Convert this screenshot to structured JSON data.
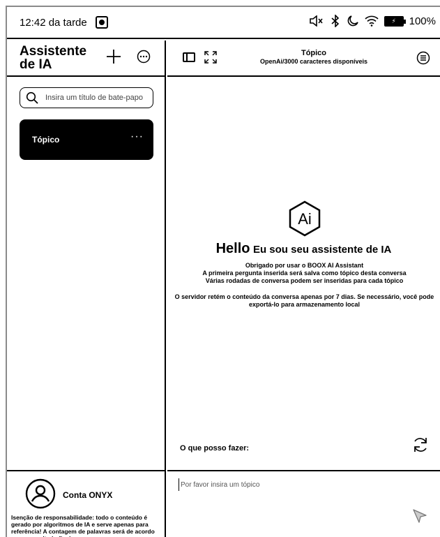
{
  "status_bar": {
    "time": "12:42 da tarde",
    "battery_level": "100%",
    "icons": [
      "mute-icon",
      "bluetooth-icon",
      "moon-icon",
      "wifi-icon",
      "battery-icon"
    ]
  },
  "sidebar": {
    "title": "Assistente de IA",
    "search_placeholder": "Insira um título de bate-papo",
    "topics": [
      {
        "label": "Tópico",
        "menu": "···"
      }
    ],
    "account_name": "Conta ONYX",
    "disclaimer": "Isenção de responsabilidade: todo o conteúdo é gerado por algoritmos de IA e serve apenas para referência! A contagem de palavras será de acordo com o resultado final."
  },
  "main": {
    "header_title": "Tópico",
    "header_subtitle": "OpenAi/3000 caracteres disponíveis",
    "logo_text": "Ai",
    "hello_big": "Hello",
    "hello_rest": "Eu sou seu assistente de IA",
    "intro_lines": [
      "Obrigado por usar o BOOX AI Assistant",
      "A primeira pergunta inserida será salva como tópico desta conversa",
      "Várias rodadas de conversa podem ser inseridas para cada tópico"
    ],
    "server_note": "O servidor retém o conteúdo da conversa apenas por 7 dias. Se necessário, você pode exportá-lo para armazenamento local",
    "what_can_label": "O que posso fazer:",
    "input_placeholder": "Por favor insira um tópico"
  }
}
